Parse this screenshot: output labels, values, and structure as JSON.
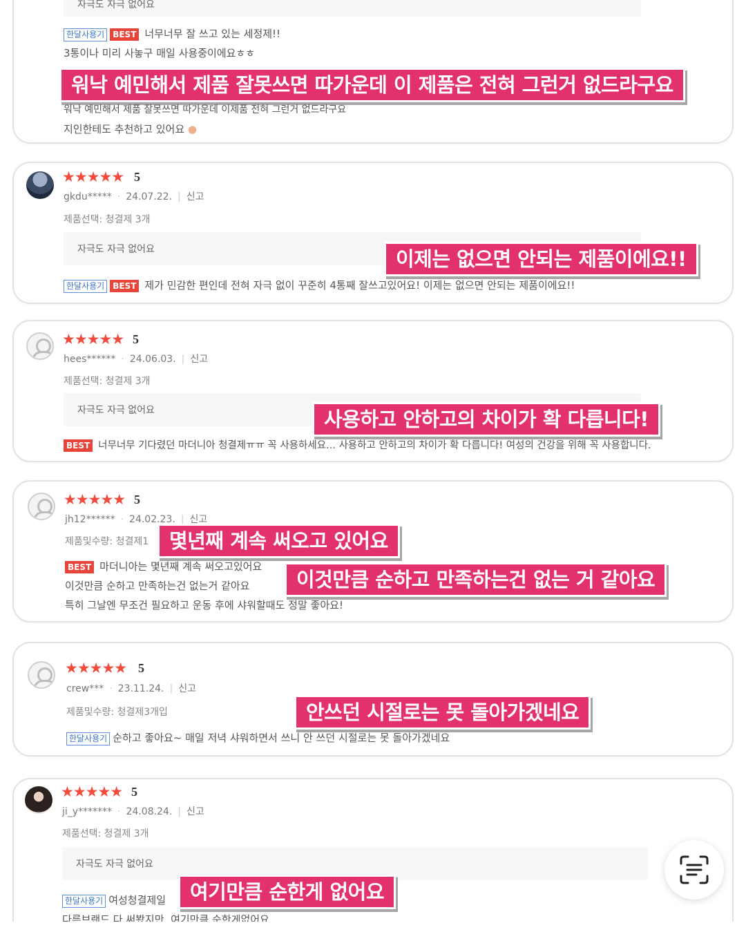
{
  "review0": {
    "gray_text": "자극도 자극 없어요",
    "line1": "너무너무 잘 쓰고 있는 세정제!!",
    "line2": "3통이나 미리 사놓구 매일 사용중이에요ㅎㅎ",
    "line3": "워낙 예민해서 제품 잘못쓰면 따가운데 이제품 전혀 그런거 없드라구요",
    "line4": "지인한테도 추천하고 있어요",
    "tag_blue": "한달사용기",
    "tag_red": "BEST",
    "highlight": "워낙 예민해서 제품 잘못쓰면 따가운데 이 제품은 전혀 그런거 없드라구요"
  },
  "review1": {
    "stars": "★★★★★",
    "score": "5",
    "user": "gkdu*****",
    "date": "24.07.22.",
    "report": "신고",
    "option": "제품선택: 청결제 3개",
    "gray_text": "자극도 자극 없어요",
    "tag_blue": "한달사용기",
    "tag_red": "BEST",
    "text": "제가 민감한 편인데 전혀 자극 없이 꾸준히 4통째 잘쓰고있어요! 이제는 없으면 안되는 제품이에요!!",
    "highlight": "이제는 없으면 안되는 제품이에요!!"
  },
  "review2": {
    "stars": "★★★★★",
    "score": "5",
    "user": "hees******",
    "date": "24.06.03.",
    "report": "신고",
    "option": "제품선택: 청결제 3개",
    "gray_text": "자극도 자극 없어요",
    "tag_red": "BEST",
    "text": "너무너무 기다렸던 마더니아 청결제ㅠㅠ 꼭 사용하세요... 사용하고 안하고의 차이가 확 다릅니다! 여성의 건강을 위해 꼭 사용합니다.",
    "highlight": "사용하고 안하고의 차이가 확 다릅니다!"
  },
  "review3": {
    "stars": "★★★★★",
    "score": "5",
    "user": "jh12******",
    "date": "24.02.23.",
    "report": "신고",
    "option": "제품및수량: 청결제1",
    "tag_red": "BEST",
    "line1": "마더니아는 몇년째 계속 써오고있어요",
    "line2": "이것만큼 순하고 만족하는건 없는거 같아요",
    "line3": "특히 그날엔 무조건 필요하고 운동 후에 샤워할때도 정말 좋아요!",
    "highlight1": "몇년째 계속 써오고 있어요",
    "highlight2": "이것만큼 순하고 만족하는건 없는 거 같아요"
  },
  "review4": {
    "stars": "★★★★★",
    "score": "5",
    "user": "crew***",
    "date": "23.11.24.",
    "report": "신고",
    "option": "제품및수량: 청결제3개입",
    "tag_blue": "한달사용기",
    "text": "순하고 좋아요~ 매일 저녁 샤워하면서 쓰니 안 쓰던 시절로는 못 돌아가겠네요",
    "highlight": "안쓰던 시절로는 못 돌아가겠네요"
  },
  "review5": {
    "stars": "★★★★★",
    "score": "5",
    "user": "ji_y*******",
    "date": "24.08.24.",
    "report": "신고",
    "option": "제품선택: 청결제 3개",
    "gray_text": "자극도 자극 없어요",
    "tag_blue": "한달사용기",
    "text": "여성청결제일",
    "line2": "다른브랜드 다 써봤지만, 여기만큼 순한게없어요",
    "highlight": "여기만큼 순한게 없어요"
  },
  "scan_button_icon": "text-scan-icon"
}
